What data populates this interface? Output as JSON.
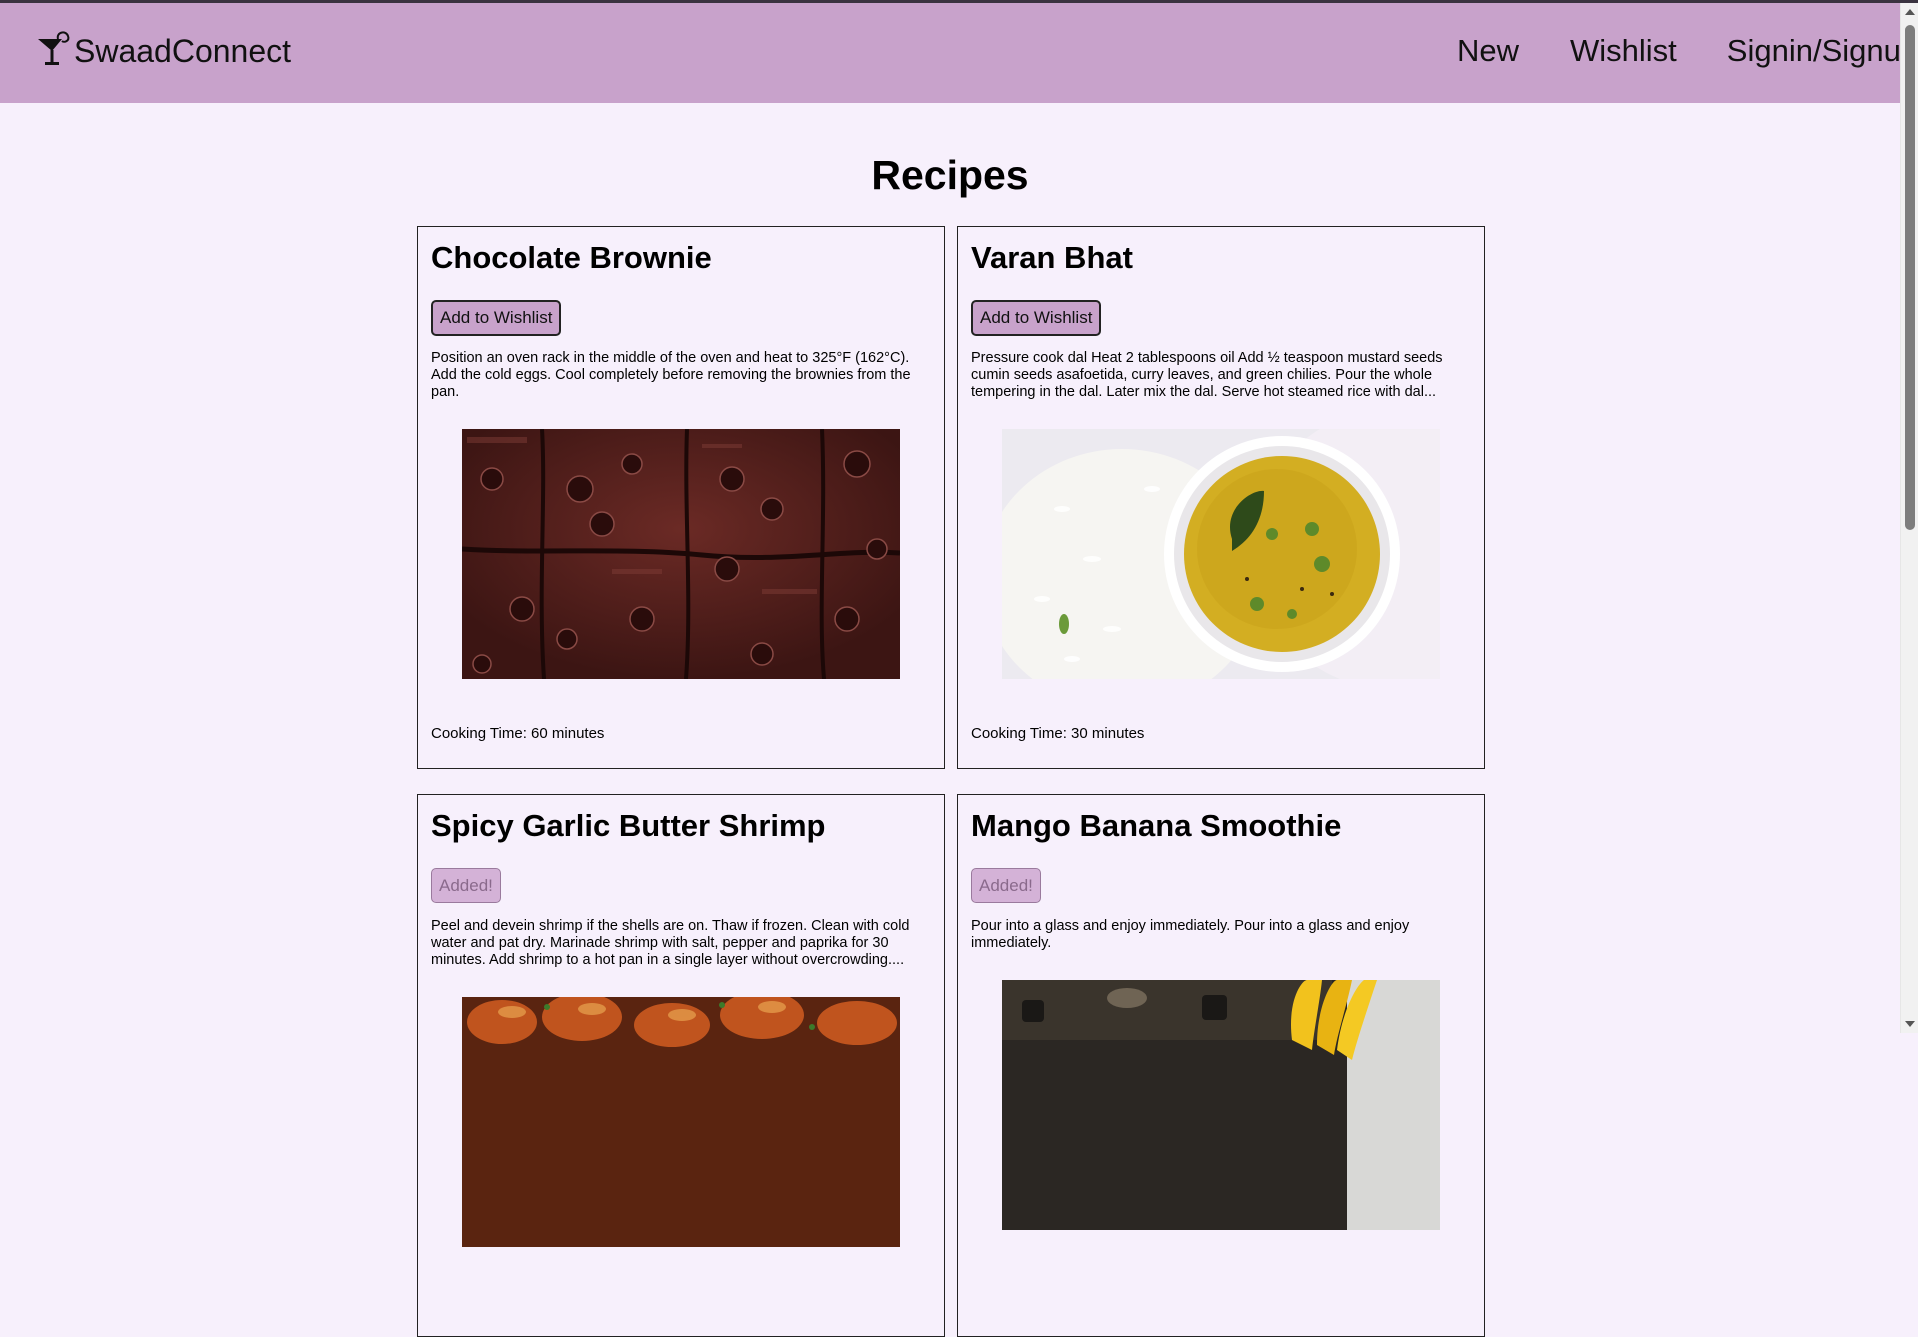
{
  "header": {
    "brand": "SwaadConnect",
    "nav": {
      "new": "New",
      "wishlist": "Wishlist",
      "signin": "Signin/Signup"
    }
  },
  "page": {
    "title": "Recipes"
  },
  "recipes": [
    {
      "title": "Chocolate Brownie",
      "button": "Add to Wishlist",
      "description": "Position an oven rack in the middle of the oven and heat to 325°F (162°C). Add the cold eggs. Cool completely before removing the brownies from the pan.",
      "time": "Cooking Time: 60 minutes"
    },
    {
      "title": "Varan Bhat",
      "button": "Add to Wishlist",
      "description": "Pressure cook dal Heat 2 tablespoons oil Add ½ teaspoon mustard seeds cumin seeds asafoetida, curry leaves, and green chilies. Pour the whole tempering in the dal. Later mix the dal. Serve hot steamed rice with dal...",
      "time": "Cooking Time: 30 minutes"
    },
    {
      "title": "Spicy Garlic Butter Shrimp",
      "button": "Added!",
      "description": "Peel and devein shrimp if the shells are on. Thaw if frozen. Clean with cold water and pat dry. Marinade shrimp with salt, pepper and paprika for 30 minutes. Add shrimp to a hot pan in a single layer without overcrowding....",
      "time": ""
    },
    {
      "title": "Mango Banana Smoothie",
      "button": "Added!",
      "description": "Pour into a glass and enjoy immediately. Pour into a glass and enjoy immediately.",
      "time": ""
    }
  ],
  "colors": {
    "navbar": "#c8a2cb",
    "background": "#f7f0fc",
    "button": "#c8a2cb"
  },
  "icons": {
    "logo": "cocktail-glass-icon"
  }
}
